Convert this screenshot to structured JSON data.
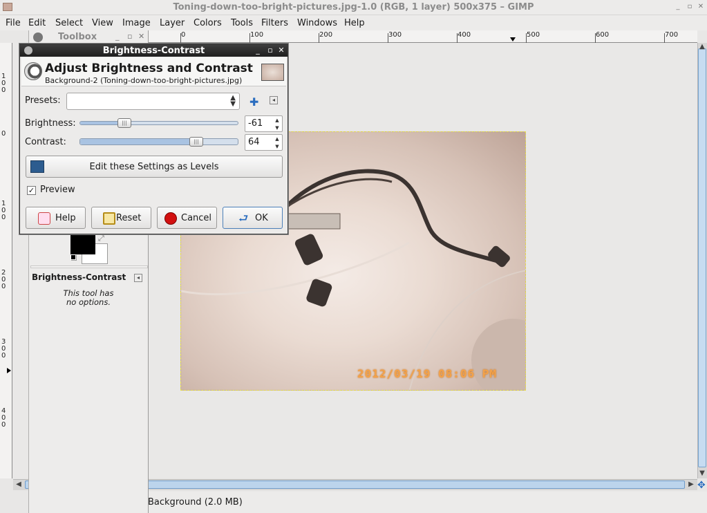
{
  "window": {
    "title": "Toning-down-too-bright-pictures.jpg-1.0 (RGB, 1 layer) 500x375 – GIMP"
  },
  "menu": [
    "File",
    "Edit",
    "Select",
    "View",
    "Image",
    "Layer",
    "Colors",
    "Tools",
    "Filters",
    "Windows",
    "Help"
  ],
  "ruler": {
    "top_labels": [
      "0",
      "100",
      "200",
      "300",
      "400",
      "500",
      "600",
      "700"
    ],
    "left_labels": [
      "100",
      "0",
      "100",
      "200",
      "300",
      "400"
    ]
  },
  "toolbox": {
    "title": "Toolbox",
    "options_title": "Brightness-Contrast",
    "options_text_line1": "This tool has",
    "options_text_line2": "no options."
  },
  "dialog": {
    "title": "Brightness-Contrast",
    "header_title": "Adjust Brightness and Contrast",
    "header_subtitle": "Background-2 (Toning-down-too-bright-pictures.jpg)",
    "presets_label": "Presets:",
    "presets_value": "",
    "brightness_label": "Brightness:",
    "brightness_value": "-61",
    "contrast_label": "Contrast:",
    "contrast_value": "64",
    "levels_button": "Edit these Settings as Levels",
    "preview_label": "Preview",
    "preview_checked": true,
    "help_button": "Help",
    "reset_button": "Reset",
    "cancel_button": "Cancel",
    "ok_button": "OK"
  },
  "image": {
    "date_stamp": "2012/03/19  08:06 PM"
  },
  "status": {
    "text": "Background (2.0 MB)"
  },
  "colors": {
    "accent": "#7aa3cc",
    "cancel_red": "#d21010",
    "dialog_titlebar": "#2a2a2a"
  }
}
